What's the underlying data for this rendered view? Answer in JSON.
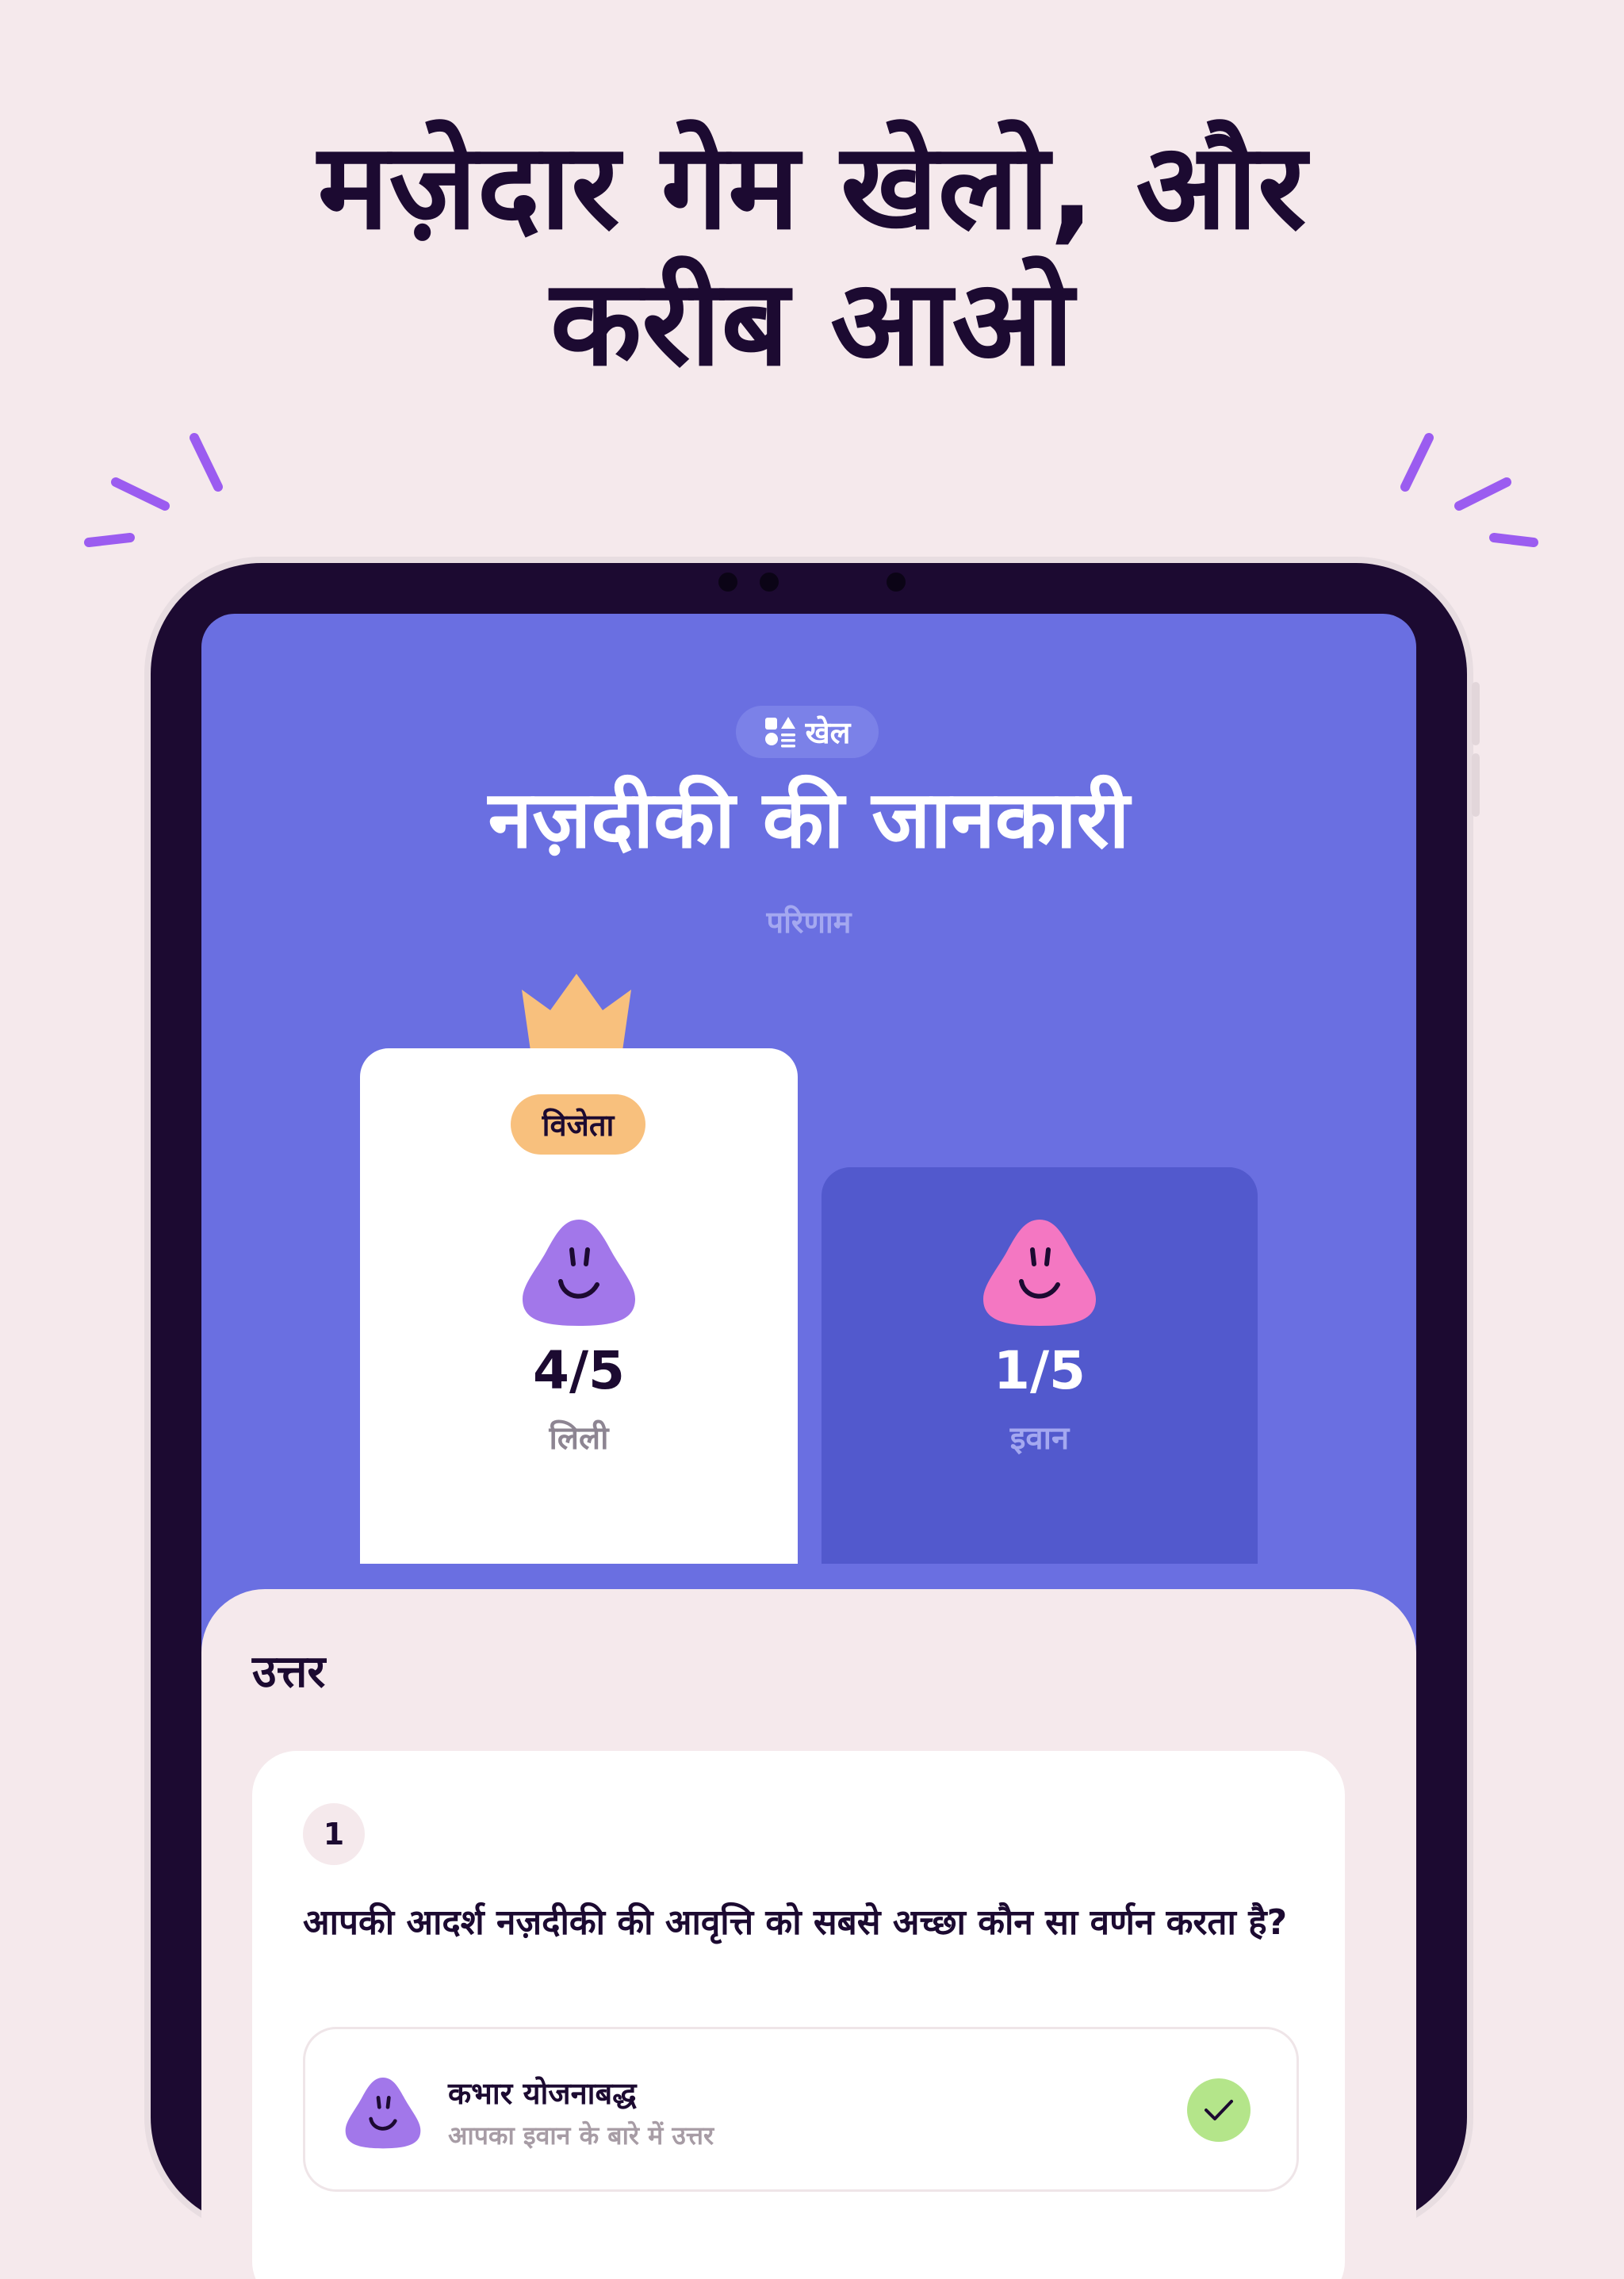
{
  "headline": {
    "line1": "मज़ेदार गेम खेलो, और",
    "line2": "करीब आओ"
  },
  "screen": {
    "category_pill": {
      "icon": "games-grid-icon",
      "label": "खेल"
    },
    "title": "नज़दीकी की जानकारी",
    "subtitle": "परिणाम",
    "results": {
      "winner": {
        "badge": "विजेता",
        "score": "4/5",
        "name": "लिली",
        "avatar_color": "#a277ea"
      },
      "runner_up": {
        "score": "1/5",
        "name": "इवान",
        "avatar_color": "#f477c2"
      }
    },
    "answers": {
      "heading": "उत्तर",
      "question": {
        "number": "1",
        "text": "आपकी आदर्श नज़दीकी की आवृत्ति को सबसे अच्छा कौन सा वर्णन करता है?",
        "answer": {
          "label": "कभार योजनाबद्ध",
          "sublabel": "आपका इवान के बारे में उत्तर",
          "correct": true
        }
      }
    }
  },
  "colors": {
    "background": "#f5e9ec",
    "text_dark": "#1c0a31",
    "accent_purple": "#9b5cf0",
    "screen_blue": "#6a6fe1",
    "card_dark_blue": "#5259cd",
    "badge_orange": "#f8c07d",
    "check_green": "#b4e58a"
  }
}
